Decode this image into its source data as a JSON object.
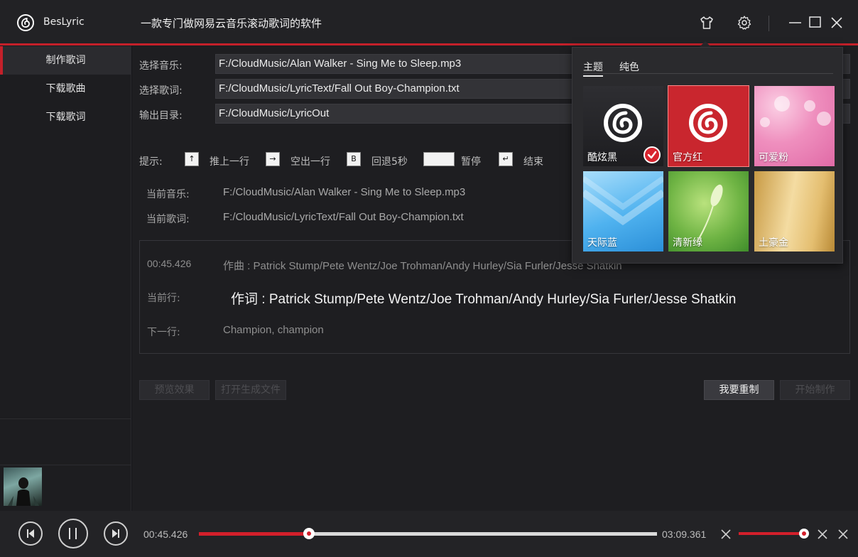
{
  "app": {
    "name": "BesLyric",
    "slogan": "一款专门做网易云音乐滚动歌词的软件"
  },
  "sidebar": {
    "items": [
      {
        "label": "制作歌词",
        "active": true
      },
      {
        "label": "下载歌曲",
        "active": false
      },
      {
        "label": "下载歌词",
        "active": false
      }
    ]
  },
  "form": {
    "music_label": "选择音乐:",
    "music_value": "F:/CloudMusic/Alan Walker - Sing Me to Sleep.mp3",
    "lyric_label": "选择歌词:",
    "lyric_value": "F:/CloudMusic/LyricText/Fall Out Boy-Champion.txt",
    "output_label": "输出目录:",
    "output_value": "F:/CloudMusic/LyricOut"
  },
  "hints": {
    "label": "提示:",
    "items": [
      {
        "key": "↑",
        "text": "推上一行"
      },
      {
        "key": "→",
        "text": "空出一行"
      },
      {
        "key": "B",
        "text": "回退5秒"
      },
      {
        "key": "",
        "text": "暂停"
      },
      {
        "key": "↵",
        "text": "结束"
      }
    ]
  },
  "current": {
    "music_label": "当前音乐:",
    "music_value": "F:/CloudMusic/Alan Walker - Sing Me to Sleep.mp3",
    "lyric_label": "当前歌词:",
    "lyric_value": "F:/CloudMusic/LyricText/Fall Out Boy-Champion.txt"
  },
  "lyrics": {
    "time": "00:45.426",
    "previous": "作曲 : Patrick Stump/Pete Wentz/Joe Trohman/Andy Hurley/Sia Furler/Jesse Shatkin",
    "current_label": "当前行:",
    "current": "作词 : Patrick Stump/Pete Wentz/Joe Trohman/Andy Hurley/Sia Furler/Jesse Shatkin",
    "next_label": "下一行:",
    "next": "Champion, champion"
  },
  "buttons": {
    "preview": "预览效果",
    "open_file": "打开生成文件",
    "reset": "我要重制",
    "start": "开始制作"
  },
  "player": {
    "elapsed": "00:45.426",
    "total": "03:09.361",
    "progress_fraction": 0.24,
    "volume_fraction": 1.0
  },
  "theme_popup": {
    "tabs": [
      {
        "label": "主题",
        "active": true
      },
      {
        "label": "纯色",
        "active": false
      }
    ],
    "themes": [
      {
        "label": "酷炫黑",
        "selected": true
      },
      {
        "label": "官方红",
        "selected": false
      },
      {
        "label": "可爱粉",
        "selected": false
      },
      {
        "label": "天际蓝",
        "selected": false
      },
      {
        "label": "清新绿",
        "selected": false
      },
      {
        "label": "土豪金",
        "selected": false
      }
    ]
  },
  "colors": {
    "accent": "#c4202a",
    "background": "#1e1e21"
  }
}
